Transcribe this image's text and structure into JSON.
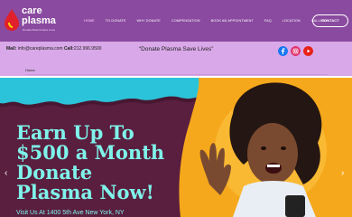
{
  "brand": {
    "line1": "care",
    "line2": "plasma",
    "tagline": "Donate Plasma Save Lives",
    "colors": {
      "header": "#8a4aa0",
      "strip": "#d9a8e8",
      "hero_bg": "#5a1e3e",
      "hero_text": "#7ff3ea",
      "logo_red": "#e0202a"
    }
  },
  "nav": {
    "items": [
      "HOME",
      "TO DONATE",
      "WHY DONATE",
      "COMPENSATION",
      "BOOK AN APPOINTMENT",
      "FAQ",
      "LOCATION",
      "GALLERY"
    ],
    "contact_button": "CONTACT"
  },
  "topbar": {
    "mail_label": "Mail:",
    "mail_value": "info@careplasma.com",
    "call_label": "Call:",
    "call_value": "212.996.9500",
    "slogan": "“Donate Plasma Save Lives”",
    "social_icons": [
      "facebook-icon",
      "instagram-icon",
      "youtube-icon"
    ]
  },
  "breadcrumb": {
    "label": "Home"
  },
  "hero": {
    "title_lines": [
      "Earn Up To",
      "$500 a Month",
      "Donate",
      "Plasma Now!"
    ],
    "subtitle": "Visit Us At 1400 5th Ave New York, NY",
    "prev_arrow": "‹",
    "next_arrow": "›"
  }
}
